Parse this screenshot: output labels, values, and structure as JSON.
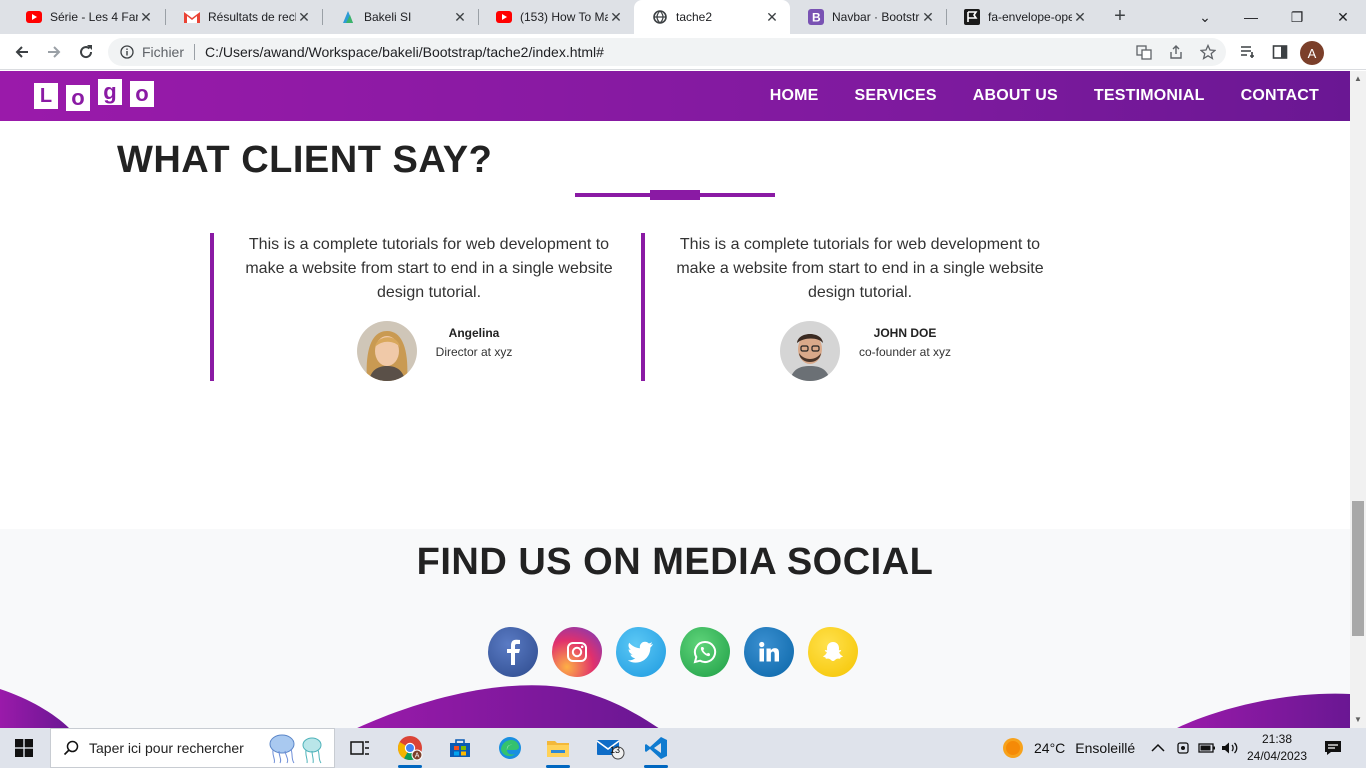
{
  "browser": {
    "tabs": [
      {
        "title": "Série - Les 4 Fant",
        "favicon": "youtube-icon",
        "active": false
      },
      {
        "title": "Résultats de rech",
        "favicon": "gmail-icon",
        "active": false
      },
      {
        "title": "Bakeli SI",
        "favicon": "bakeli-icon",
        "active": false
      },
      {
        "title": "(153) How To Ma",
        "favicon": "youtube-icon",
        "active": false
      },
      {
        "title": "tache2",
        "favicon": "globe-icon",
        "active": true
      },
      {
        "title": "Navbar · Bootstra",
        "favicon": "bootstrap-icon",
        "active": false
      },
      {
        "title": "fa-envelope-ope",
        "favicon": "flag-icon",
        "active": false
      }
    ],
    "address": {
      "scheme_label": "Fichier",
      "url": "C:/Users/awand/Workspace/bakeli/Bootstrap/tache2/index.html#"
    },
    "profile_initial": "A"
  },
  "page": {
    "logo_letters": [
      "L",
      "o",
      "g",
      "o"
    ],
    "nav": [
      "HOME",
      "SERVICES",
      "ABOUT US",
      "TESTIMONIAL",
      "CONTACT"
    ],
    "testimonials_title": "WHAT CLIENT SAY?",
    "testimonials": [
      {
        "quote": "This is a complete tutorials for web development to make a website from start to end in a single website design tutorial.",
        "name": "Angelina",
        "role": "Director at xyz"
      },
      {
        "quote": "This is a complete tutorials for web development to make a website from start to end in a single website design tutorial.",
        "name": "JOHN DOE",
        "role": "co-founder at xyz"
      }
    ],
    "social_title": "FIND US ON MEDIA SOCIAL",
    "social_icons": [
      {
        "name": "facebook-icon",
        "glyph": "f",
        "color": "#3b5998"
      },
      {
        "name": "instagram-icon",
        "glyph": "◎",
        "color": "#d62976"
      },
      {
        "name": "twitter-icon",
        "glyph": "🐦",
        "color": "#1da1f2"
      },
      {
        "name": "whatsapp-icon",
        "glyph": "✆",
        "color": "#25d366"
      },
      {
        "name": "linkedin-icon",
        "glyph": "in",
        "color": "#0077b5"
      },
      {
        "name": "snapchat-icon",
        "glyph": "👻",
        "color": "#fffc00"
      }
    ],
    "accent_color": "#8a1aa4"
  },
  "taskbar": {
    "search_placeholder": "Taper ici pour rechercher",
    "mail_badge": "13",
    "weather_temp": "24°C",
    "weather_text": "Ensoleillé",
    "time": "21:38",
    "date": "24/04/2023"
  }
}
